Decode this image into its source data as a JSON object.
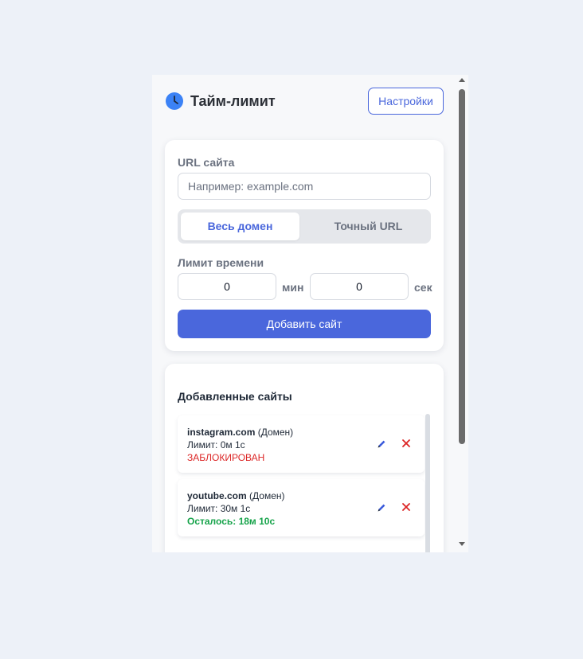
{
  "header": {
    "title": "Тайм-лимит",
    "settings_label": "Настройки",
    "logo_icon": "clock-icon",
    "logo_color": "#3b82f6"
  },
  "form": {
    "url_label": "URL сайта",
    "url_placeholder": "Например: example.com",
    "url_value": "",
    "mode_options": [
      "Весь домен",
      "Точный URL"
    ],
    "mode_selected": "Весь домен",
    "limit_label": "Лимит времени",
    "minutes_value": "0",
    "minutes_unit": "мин",
    "seconds_value": "0",
    "seconds_unit": "сек",
    "add_label": "Добавить сайт"
  },
  "sites": {
    "title": "Добавленные сайты",
    "items": [
      {
        "domain": "instagram.com",
        "type": "(Домен)",
        "limit": "Лимит: 0м 1с",
        "status": "ЗАБЛОКИРОВАН",
        "status_kind": "blocked"
      },
      {
        "domain": "youtube.com",
        "type": "(Домен)",
        "limit": "Лимит: 30м 1с",
        "status": "Осталось: 18м 10с",
        "status_kind": "remaining"
      }
    ],
    "edit_icon": "pencil-icon",
    "delete_icon": "close-icon"
  },
  "colors": {
    "accent": "#4a67dc",
    "blocked": "#dc2626",
    "remaining": "#16a34a",
    "background": "#edf1f8"
  }
}
